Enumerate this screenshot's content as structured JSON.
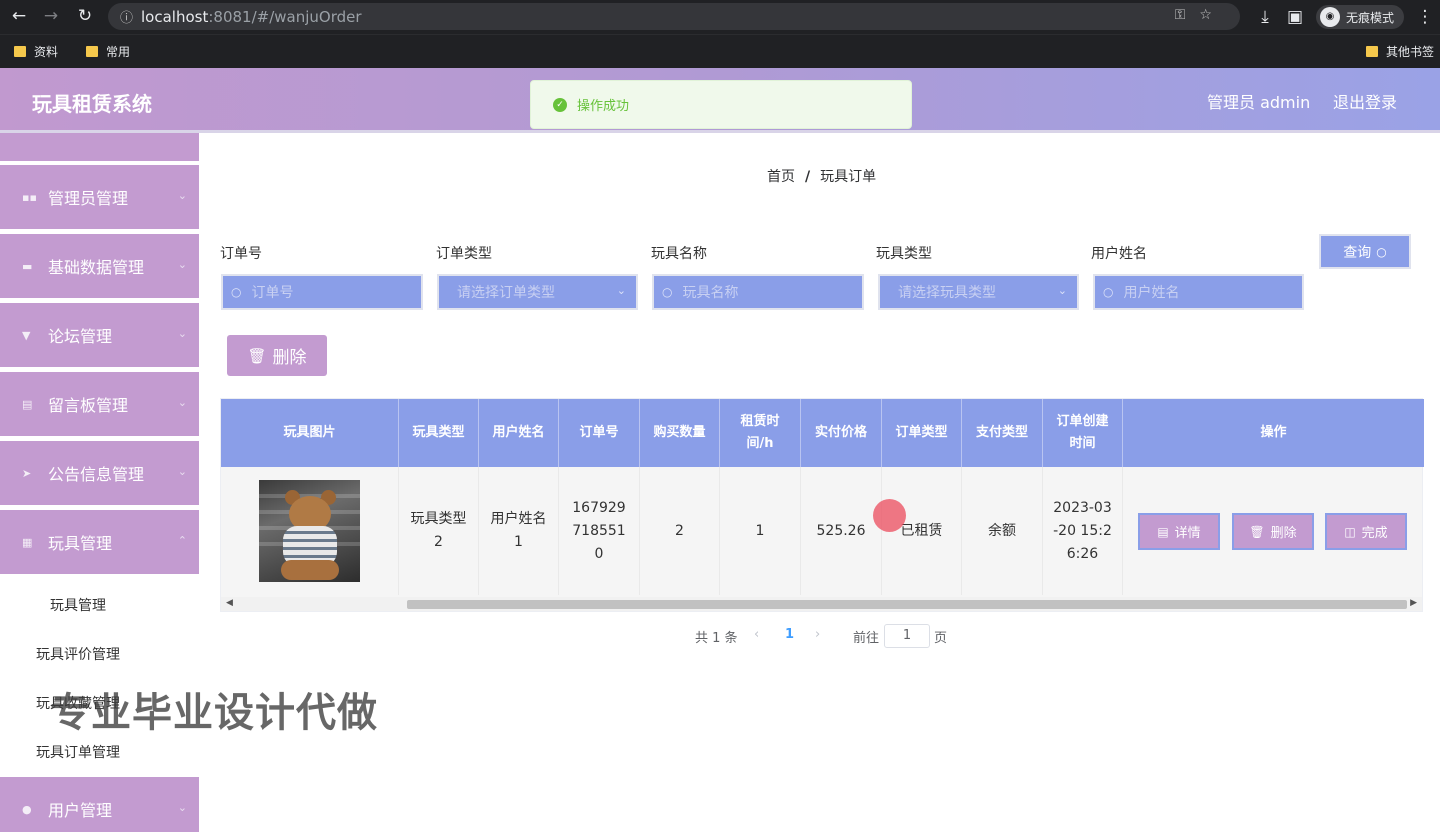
{
  "browser": {
    "url_host": "localhost",
    "url_rest": ":8081/#/wanjuOrder",
    "incognito_label": "无痕模式",
    "bookmarks": [
      "资料",
      "常用"
    ],
    "other_bookmarks": "其他书签"
  },
  "header": {
    "title": "玩具租赁系统",
    "admin": "管理员 admin",
    "logout": "退出登录"
  },
  "toast": {
    "message": "操作成功"
  },
  "sidebar": {
    "items": [
      {
        "label": "管理员管理"
      },
      {
        "label": "基础数据管理"
      },
      {
        "label": "论坛管理"
      },
      {
        "label": "留言板管理"
      },
      {
        "label": "公告信息管理"
      },
      {
        "label": "玩具管理"
      },
      {
        "label": "用户管理"
      }
    ],
    "sub_items": [
      "玩具管理",
      "玩具评价管理",
      "玩具收藏管理",
      "玩具订单管理"
    ]
  },
  "watermark": "专业毕业设计代做",
  "breadcrumb": {
    "home": "首页",
    "sep": "/",
    "current": "玩具订单"
  },
  "filters": [
    {
      "label": "订单号",
      "placeholder": "订单号"
    },
    {
      "label": "订单类型",
      "placeholder": "请选择订单类型"
    },
    {
      "label": "玩具名称",
      "placeholder": "玩具名称"
    },
    {
      "label": "玩具类型",
      "placeholder": "请选择玩具类型"
    },
    {
      "label": "用户姓名",
      "placeholder": "用户姓名"
    }
  ],
  "query_button": "查询",
  "delete_button": "删除",
  "table": {
    "headers": [
      "玩具图片",
      "玩具类型",
      "用户姓名",
      "订单号",
      "购买数量",
      "租赁时间/h",
      "实付价格",
      "订单类型",
      "支付类型",
      "订单创建时间",
      "操作"
    ],
    "row": {
      "toy_type": "玩具类型2",
      "user_name": "用户姓名1",
      "order_no": "1679297185510",
      "quantity": "2",
      "rent_hours": "1",
      "price": "525.26",
      "order_type": "已租赁",
      "pay_type": "余额",
      "created": "2023-03-20 15:26:26"
    },
    "actions": [
      "详情",
      "删除",
      "完成"
    ]
  },
  "pagination": {
    "total": "共 1 条",
    "current": "1",
    "goto": "前往",
    "page_value": "1",
    "page_unit": "页"
  }
}
